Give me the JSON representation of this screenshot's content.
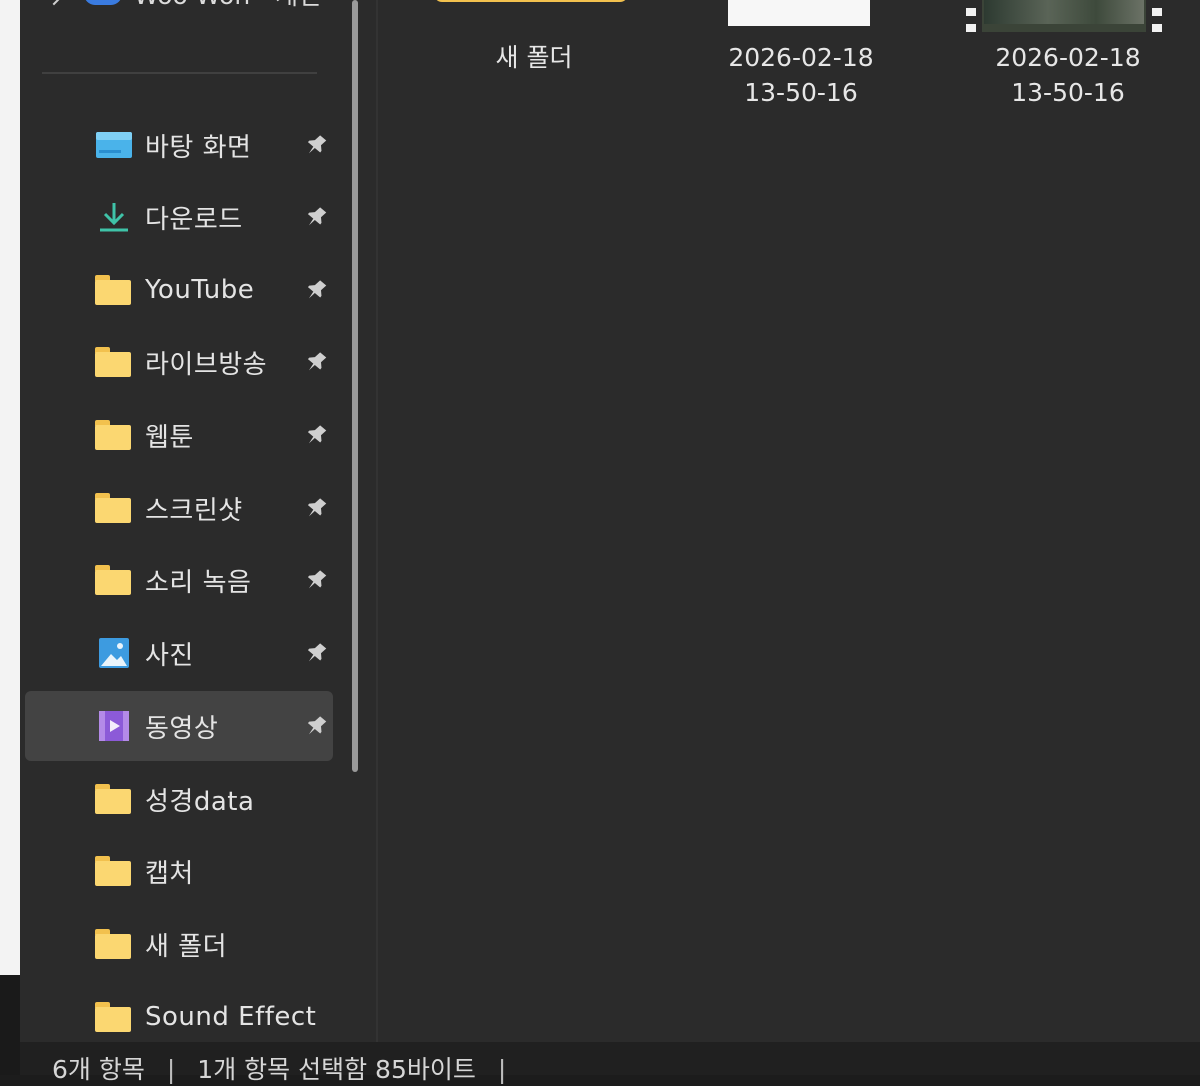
{
  "nav": {
    "top_item": "Woo Won - 개인",
    "items": [
      {
        "label": "바탕 화면",
        "icon": "desktop-icon",
        "pinned": true,
        "selected": false
      },
      {
        "label": "다운로드",
        "icon": "download-icon",
        "pinned": true,
        "selected": false
      },
      {
        "label": "YouTube",
        "icon": "folder-icon",
        "pinned": true,
        "selected": false
      },
      {
        "label": "라이브방송",
        "icon": "folder-icon",
        "pinned": true,
        "selected": false
      },
      {
        "label": "웹툰",
        "icon": "folder-icon",
        "pinned": true,
        "selected": false
      },
      {
        "label": "스크린샷",
        "icon": "folder-icon",
        "pinned": true,
        "selected": false
      },
      {
        "label": "소리 녹음",
        "icon": "folder-icon",
        "pinned": true,
        "selected": false
      },
      {
        "label": "사진",
        "icon": "pictures-icon",
        "pinned": true,
        "selected": false
      },
      {
        "label": "동영상",
        "icon": "videos-icon",
        "pinned": true,
        "selected": true
      },
      {
        "label": "성경data",
        "icon": "folder-icon",
        "pinned": false,
        "selected": false
      },
      {
        "label": "캡처",
        "icon": "folder-icon",
        "pinned": false,
        "selected": false
      },
      {
        "label": "새 폴더",
        "icon": "folder-icon",
        "pinned": false,
        "selected": false
      },
      {
        "label": "Sound Effect",
        "icon": "folder-icon",
        "pinned": false,
        "selected": false
      }
    ]
  },
  "files": [
    {
      "line1": "새 폴더",
      "line2": ""
    },
    {
      "line1": "2026-02-18",
      "line2": "13-50-16"
    },
    {
      "line1": "2026-02-18",
      "line2": "13-50-16"
    }
  ],
  "status": {
    "item_count": "6개 항목",
    "selection": "1개 항목 선택함 85바이트"
  },
  "colors": {
    "folder": "#fbd771",
    "accent": "#3a7be0",
    "selected_bg": "#434343"
  }
}
